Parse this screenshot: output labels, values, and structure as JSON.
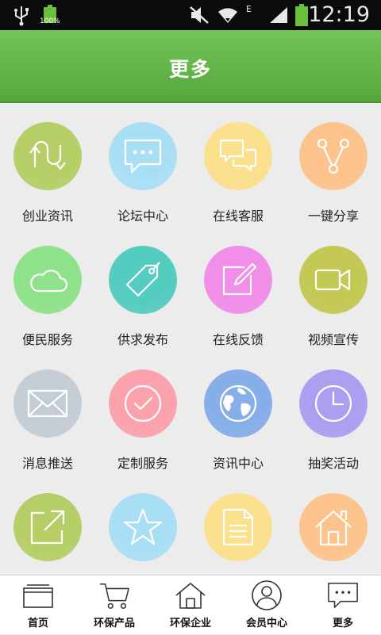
{
  "status_bar": {
    "battery_percent": "100%",
    "network_label": "E",
    "time": "12:19"
  },
  "header": {
    "title": "更多"
  },
  "grid_items": [
    {
      "label": "创业资讯",
      "icon": "u-turn-arrows-icon",
      "color": "#b5cf66"
    },
    {
      "label": "论坛中心",
      "icon": "chat-bubble-dots-icon",
      "color": "#a9dff5"
    },
    {
      "label": "在线客服",
      "icon": "chat-bubbles-icon",
      "color": "#fbe08d"
    },
    {
      "label": "一键分享",
      "icon": "share-icon",
      "color": "#fdc38c"
    },
    {
      "label": "便民服务",
      "icon": "cloud-icon",
      "color": "#8fe28a"
    },
    {
      "label": "供求发布",
      "icon": "tag-icon",
      "color": "#55ccc0"
    },
    {
      "label": "在线反馈",
      "icon": "edit-icon",
      "color": "#f08ee8"
    },
    {
      "label": "视频宣传",
      "icon": "video-camera-icon",
      "color": "#c4c855"
    },
    {
      "label": "消息推送",
      "icon": "envelope-icon",
      "color": "#c4ccd4"
    },
    {
      "label": "定制服务",
      "icon": "check-circle-icon",
      "color": "#fca2ac"
    },
    {
      "label": "资讯中心",
      "icon": "globe-icon",
      "color": "#86aee8"
    },
    {
      "label": "抽奖活动",
      "icon": "clock-icon",
      "color": "#ad9ef0"
    },
    {
      "label": "",
      "icon": "external-link-icon",
      "color": "#b5cf66"
    },
    {
      "label": "",
      "icon": "star-icon",
      "color": "#a9dff5"
    },
    {
      "label": "",
      "icon": "document-icon",
      "color": "#fbe08d"
    },
    {
      "label": "",
      "icon": "home-icon",
      "color": "#fdc38c"
    }
  ],
  "tab_bar": [
    {
      "label": "首页",
      "icon": "window-icon"
    },
    {
      "label": "环保产品",
      "icon": "cart-icon"
    },
    {
      "label": "环保企业",
      "icon": "house-icon"
    },
    {
      "label": "会员中心",
      "icon": "user-icon"
    },
    {
      "label": "更多",
      "icon": "more-icon"
    }
  ]
}
